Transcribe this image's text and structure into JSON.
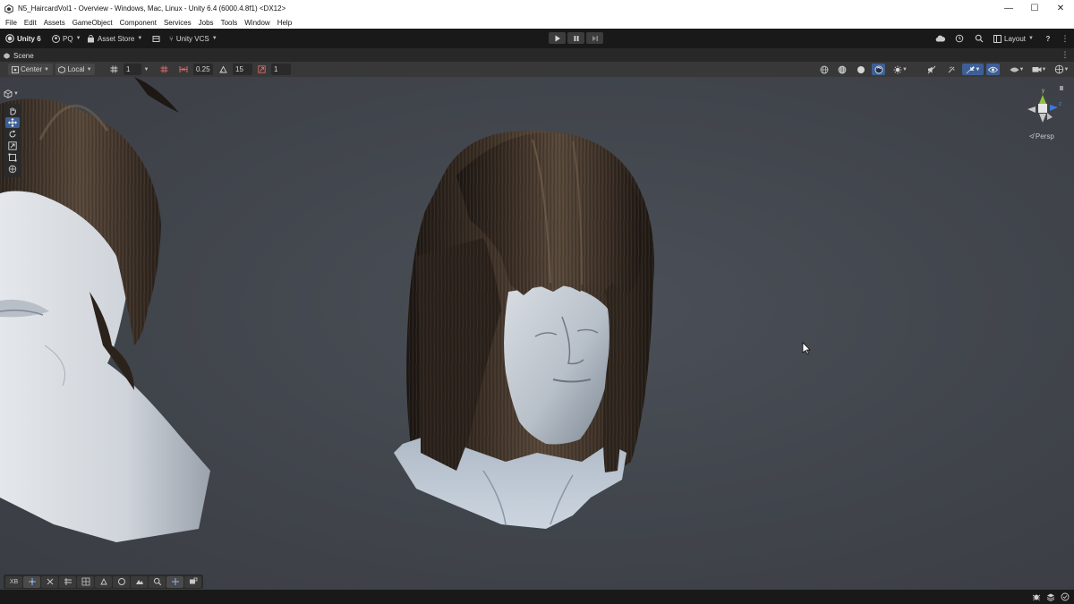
{
  "window": {
    "title": "N5_HaircardVol1 - Overview - Windows, Mac, Linux - Unity 6.4 (6000.4.8f1) <DX12>",
    "minimize": "—",
    "maximize": "☐",
    "close": "✕"
  },
  "menu": [
    "File",
    "Edit",
    "Assets",
    "GameObject",
    "Component",
    "Services",
    "Jobs",
    "Tools",
    "Window",
    "Help"
  ],
  "toolbar": {
    "unity_label": "Unity 6",
    "account_label": "PQ",
    "asset_store_label": "Asset Store",
    "vcs_label": "Unity VCS",
    "layout_label": "Layout",
    "help_label": "?"
  },
  "scene_tab": {
    "label": "Scene"
  },
  "scene_toolbar": {
    "pivot_label": "Center",
    "space_label": "Local",
    "grid_value": "1",
    "snap_move": "0.25",
    "snap_rotate": "15",
    "snap_scale": "1"
  },
  "viewport": {
    "camera_label": "≮ Persp",
    "gizmo_axes": {
      "y": "y",
      "z": "z"
    }
  },
  "overlay_bar": {
    "xr_label": "XB"
  },
  "icons": {
    "tools": [
      "hand-icon",
      "move-icon",
      "rotate-icon",
      "scale-icon",
      "rect-icon",
      "transform-icon"
    ],
    "accent": "#3e5f96"
  }
}
